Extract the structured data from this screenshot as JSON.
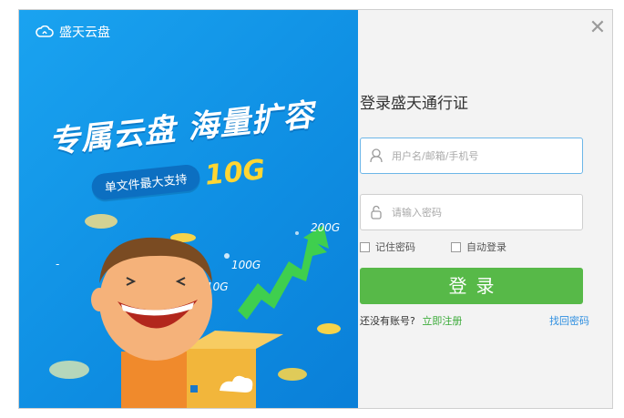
{
  "brand": {
    "name": "盛天云盘",
    "logo_icon": "cloud-logo-icon"
  },
  "promo": {
    "headline": "专属云盘 海量扩容",
    "sub_text": "单文件最大支持",
    "capacity": "10G",
    "growth_labels": [
      "200G",
      "100G",
      "10G"
    ]
  },
  "window": {
    "close_label": "✕"
  },
  "form": {
    "title": "登录盛天通行证",
    "username_placeholder": "用户名/邮箱/手机号",
    "password_placeholder": "请输入密码",
    "remember_label": "记住密码",
    "autologin_label": "自动登录",
    "login_label": "登录",
    "no_account_text": "还没有账号?",
    "register_label": "立即注册",
    "forgot_label": "找回密码"
  },
  "colors": {
    "accent_green": "#57b948",
    "link_green": "#3cab3a",
    "link_blue": "#2f8fe0",
    "promo_blue": "#1aa3f0"
  }
}
